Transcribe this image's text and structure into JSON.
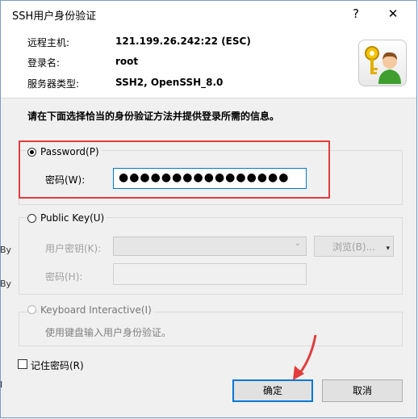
{
  "window": {
    "title": "SSH用户身份验证",
    "help_label": "?",
    "close_label": "✕"
  },
  "info": {
    "host_label": "远程主机:",
    "host_value": "121.199.26.242:22 (ESC)",
    "login_label": "登录名:",
    "login_value": "root",
    "server_label": "服务器类型:",
    "server_value": "SSH2, OpenSSH_8.0"
  },
  "instruction": "请在下面选择恰当的身份验证方法并提供登录所需的信息。",
  "password_group": {
    "option_label": "Password(P)",
    "selected": true,
    "pwd_label": "密码(W):",
    "pwd_value": "●●●●●●●●●●●●●●●●"
  },
  "pubkey_group": {
    "option_label": "Public Key(U)",
    "selected": false,
    "user_key_label": "用户密钥(K):",
    "browse_label": "浏览(B)...",
    "passphrase_label": "密码(H):"
  },
  "keyboard_group": {
    "option_label": "Keyboard Interactive(I)",
    "selected": false,
    "description": "使用键盘输入用户身份验证。"
  },
  "remember_label": "记住密码(R)",
  "buttons": {
    "ok": "确定",
    "cancel": "取消"
  },
  "background_glyphs": [
    "By",
    "By",
    "I"
  ],
  "colors": {
    "highlight": "#e23c3c",
    "accent": "#0078d7"
  }
}
